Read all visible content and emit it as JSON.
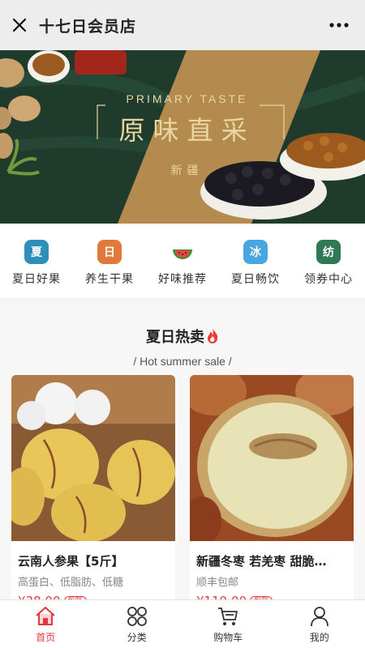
{
  "header": {
    "title": "十七日会员店"
  },
  "banner": {
    "subtitle": "PRIMARY TASTE",
    "headline": "原味直采",
    "region": "新疆"
  },
  "nav": [
    {
      "label": "夏日好果",
      "icon": "fruit-badge-icon",
      "glyph": "夏",
      "color": "#2f8fb8"
    },
    {
      "label": "养生干果",
      "icon": "nuts-badge-icon",
      "glyph": "日",
      "color": "#e07a3a"
    },
    {
      "label": "好味推荐",
      "icon": "watermelon-icon",
      "glyph": "",
      "color": "#ffffff"
    },
    {
      "label": "夏日畅饮",
      "icon": "drink-badge-icon",
      "glyph": "冰",
      "color": "#4aa6e0"
    },
    {
      "label": "领券中心",
      "icon": "coupon-badge-icon",
      "glyph": "纺",
      "color": "#2f7a55"
    }
  ],
  "section": {
    "title": "夏日热卖",
    "subtitle": "/ Hot summer sale /"
  },
  "products": [
    {
      "name": "云南人参果【5斤】",
      "desc": "高蛋白、低脂肪、低糖",
      "price": "¥38.00",
      "tag": "包邮"
    },
    {
      "name": "新疆冬枣 若羌枣 甜脆…",
      "desc": "顺丰包邮",
      "price": "¥119.00",
      "tag": "包邮"
    }
  ],
  "tabs": [
    {
      "label": "首页",
      "icon": "home-icon",
      "active": true
    },
    {
      "label": "分类",
      "icon": "category-icon",
      "active": false
    },
    {
      "label": "购物车",
      "icon": "cart-icon",
      "active": false
    },
    {
      "label": "我的",
      "icon": "user-icon",
      "active": false
    }
  ],
  "colors": {
    "accent": "#e4393c",
    "banner_bg": "#1f3b2c",
    "banner_gold": "#e9d7a3"
  }
}
